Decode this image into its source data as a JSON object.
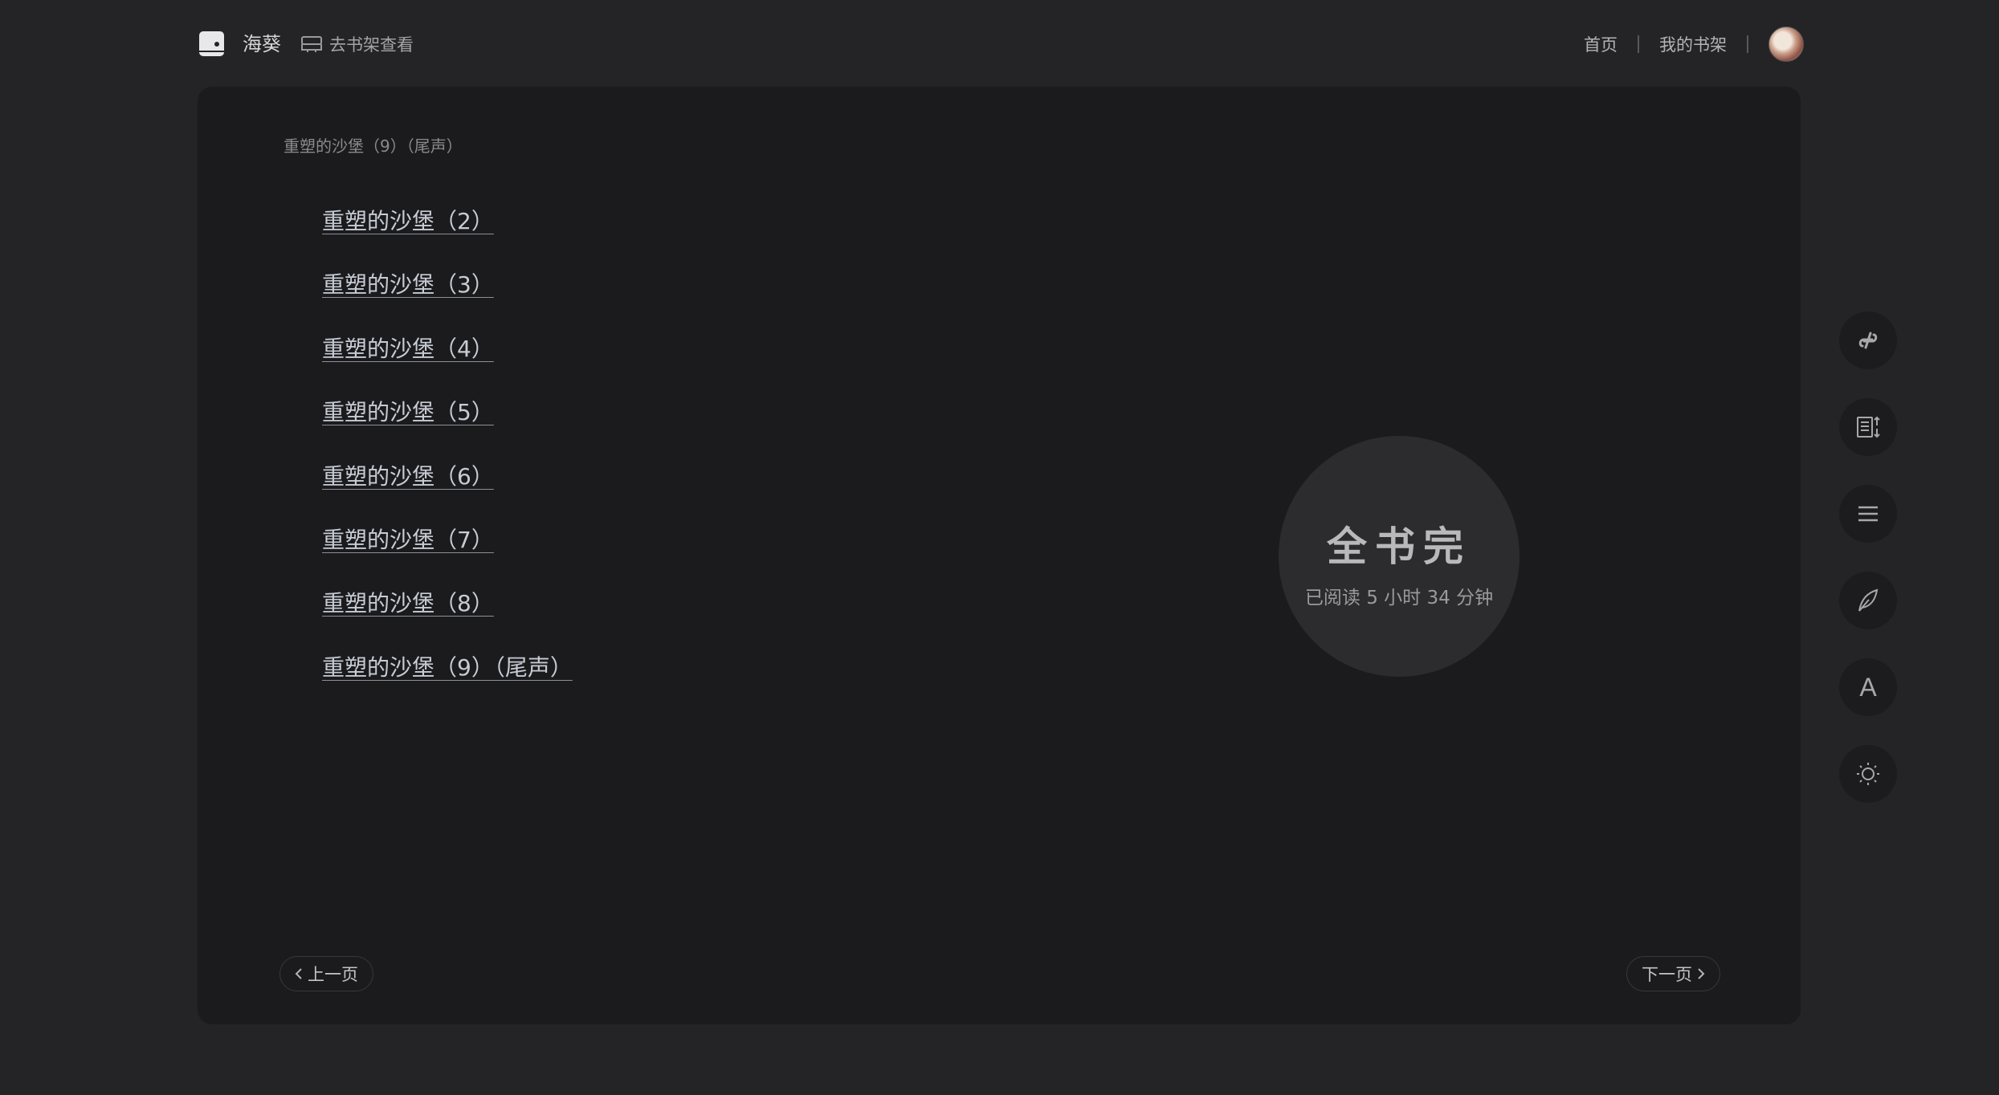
{
  "header": {
    "app_name": "海葵",
    "shelf_link": "去书架查看",
    "nav": {
      "home": "首页",
      "my_shelf": "我的书架"
    }
  },
  "reader": {
    "current_chapter": "重塑的沙堡（9）（尾声）",
    "toc": [
      "重塑的沙堡（2）",
      "重塑的沙堡（3）",
      "重塑的沙堡（4）",
      "重塑的沙堡（5）",
      "重塑的沙堡（6）",
      "重塑的沙堡（7）",
      "重塑的沙堡（8）",
      "重塑的沙堡（9）（尾声）"
    ],
    "end": {
      "title": "全书完",
      "read_time": "已阅读 5 小时 34 分钟"
    },
    "prev_label": "上一页",
    "next_label": "下一页"
  },
  "sidebar_tools": [
    {
      "icon": "link-icon"
    },
    {
      "icon": "chapter-sort-icon"
    },
    {
      "icon": "menu-icon"
    },
    {
      "icon": "feather-icon"
    },
    {
      "icon": "font-icon",
      "glyph": "A"
    },
    {
      "icon": "brightness-icon"
    }
  ]
}
